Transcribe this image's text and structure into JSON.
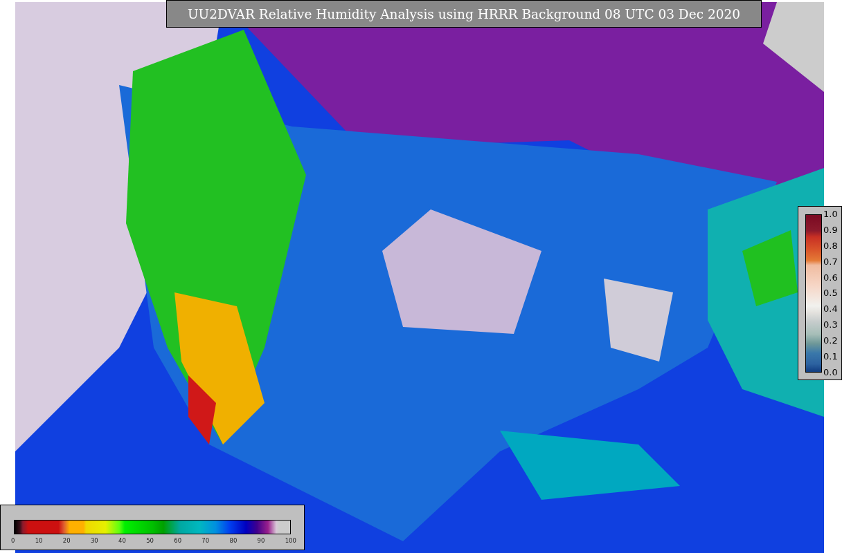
{
  "title": "UU2DVAR Relative Humidity Analysis using HRRR Background 08 UTC 03 Dec 2020",
  "error_legend": {
    "ticks": [
      "1.0",
      "0.9",
      "0.8",
      "0.7",
      "0.6",
      "0.5",
      "0.4",
      "0.3",
      "0.2",
      "0.1",
      "0.0"
    ]
  },
  "humidity_legend": {
    "ticks": [
      "0",
      "10",
      "20",
      "30",
      "40",
      "50",
      "60",
      "70",
      "80",
      "90",
      "100"
    ]
  }
}
